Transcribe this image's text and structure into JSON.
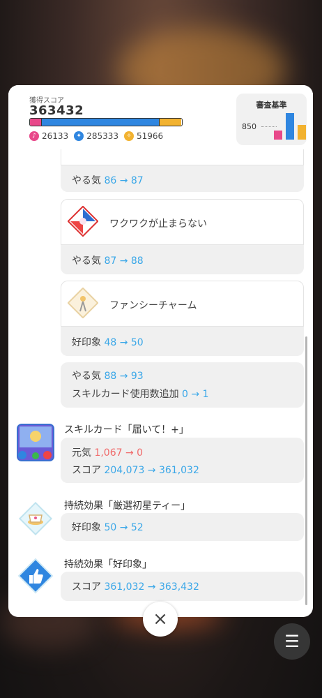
{
  "score": {
    "label": "獲得スコア",
    "value": "363432",
    "bar": {
      "pink_fraction": 0.072,
      "blue_fraction": 0.785,
      "orange_fraction": 0.143
    },
    "stats": [
      {
        "icon": "vocal-icon",
        "value": "26133",
        "color": "#e8488a"
      },
      {
        "icon": "dance-icon",
        "value": "285333",
        "color": "#2f86e0"
      },
      {
        "icon": "visual-icon",
        "value": "51966",
        "color": "#f2b230"
      }
    ]
  },
  "criteria": {
    "title": "審査基準",
    "value": "850",
    "bars": {
      "pink_fraction": 0.35,
      "blue_fraction": 1.0,
      "orange_fraction": 0.55
    }
  },
  "rows": {
    "r1": {
      "stat": "やる気",
      "change": "86 → 87"
    },
    "card2": {
      "name": "ワクワクが止まらない"
    },
    "r2": {
      "stat": "やる気",
      "change": "87 → 88"
    },
    "card3": {
      "name": "ファンシーチャーム"
    },
    "r3": {
      "stat": "好印象",
      "change": "48 → 50"
    },
    "r4a": {
      "stat": "やる気",
      "change": "88 → 93"
    },
    "r4b": {
      "stat": "スキルカード使用数追加",
      "change": "0 → 1"
    }
  },
  "skill": {
    "title": "スキルカード「届いて！+」",
    "line1": {
      "stat": "元気",
      "change": "1,067 → 0"
    },
    "line2": {
      "stat": "スコア",
      "change": "204,073 → 361,032"
    }
  },
  "effect1": {
    "title": "持続効果「厳選初星ティー」",
    "line": {
      "stat": "好印象",
      "change": "50 → 52"
    }
  },
  "effect2": {
    "title": "持続効果「好印象」",
    "line": {
      "stat": "スコア",
      "change": "361,032 → 363,432"
    }
  },
  "icons": {
    "close": "×",
    "menu": "☰"
  }
}
